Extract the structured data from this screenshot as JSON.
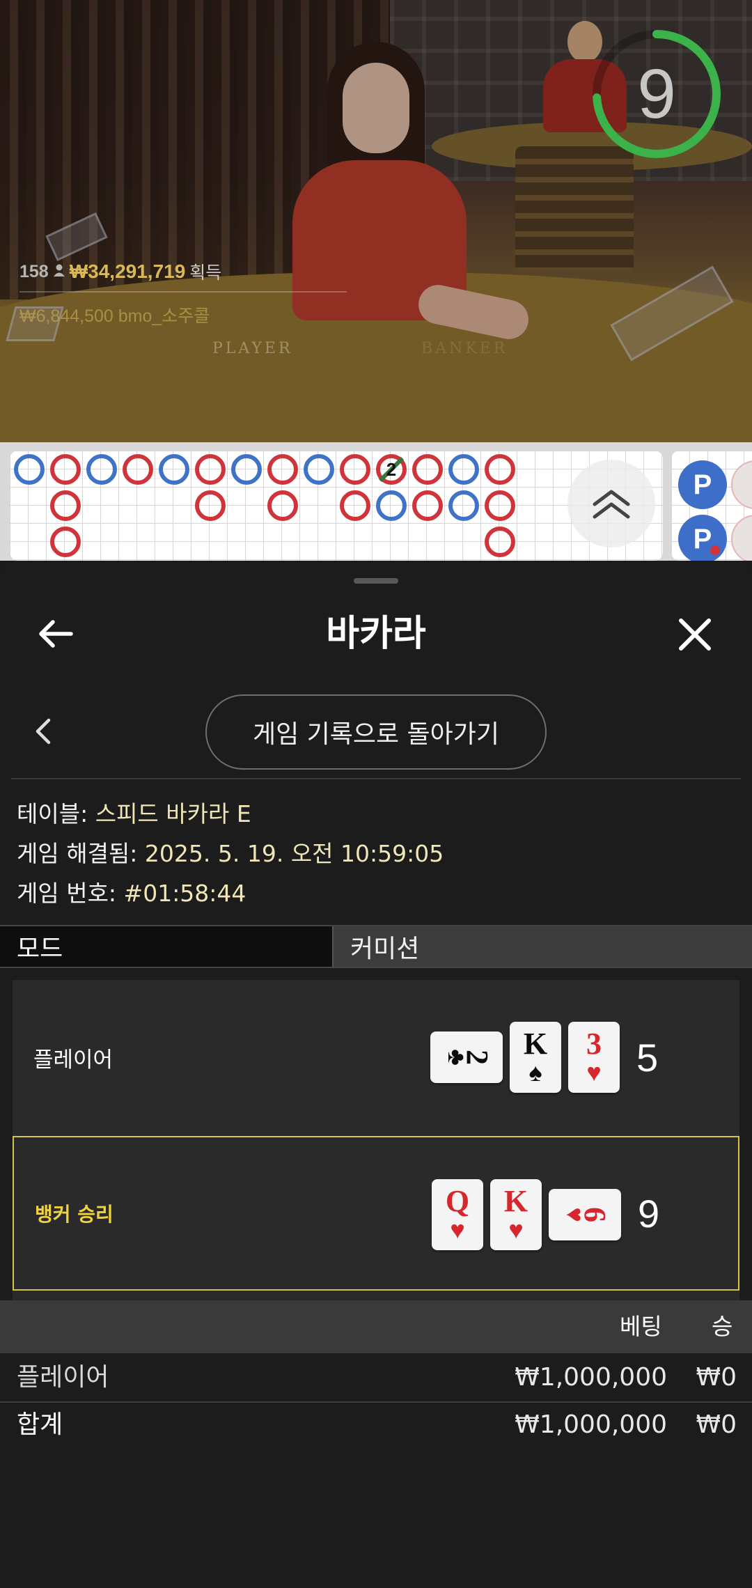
{
  "video": {
    "timer_value": "9",
    "timer_color": "#3cb24a",
    "felt_player": "PLAYER",
    "felt_banker": "BANKER"
  },
  "stats": {
    "players": "158",
    "payout": "₩34,291,719",
    "payout_suffix": "획득",
    "last_win": "₩6,844,500  bmo_소주콜"
  },
  "roadmap": {
    "colors": {
      "banker": "#d0343a",
      "player": "#3f73c8",
      "tie": "#2f7a3a"
    },
    "beads": [
      [
        "P"
      ],
      [
        "B",
        "B",
        "B"
      ],
      [
        "P"
      ],
      [
        "B"
      ],
      [
        "P"
      ],
      [
        "B",
        "B"
      ],
      [
        "P"
      ],
      [
        "B",
        "B"
      ],
      [
        "P"
      ],
      [
        "B",
        "B"
      ],
      [
        "T2",
        "P"
      ],
      [
        "B",
        "B"
      ],
      [
        "P",
        "P"
      ],
      [
        "B",
        "B",
        "B"
      ]
    ],
    "side_badge": "P",
    "scroll_icon": "double-chevron-up-icon"
  },
  "sheet": {
    "title": "바카라",
    "back_icon": "arrow-left-icon",
    "close_icon": "close-icon",
    "nav_prev_icon": "chevron-left-icon",
    "back_to_history": "게임 기록으로 돌아가기",
    "info": {
      "table_label": "테이블: ",
      "table_value": "스피드 바카라 E",
      "resolved_label": "게임 해결됨: ",
      "resolved_value": "2025. 5. 19. 오전 10:59:05",
      "round_label": "게임 번호: ",
      "round_value": "#01:58:44"
    },
    "tabs": {
      "mode": "모드",
      "commission": "커미션"
    },
    "hands": {
      "player": {
        "label": "플레이어",
        "score": "5",
        "cards": [
          {
            "rank": "2",
            "suit": "♣",
            "color": "black",
            "rotated": true
          },
          {
            "rank": "K",
            "suit": "♠",
            "color": "black",
            "rotated": false
          },
          {
            "rank": "3",
            "suit": "♥",
            "color": "red",
            "rotated": false
          }
        ]
      },
      "banker": {
        "label": "뱅커 승리",
        "score": "9",
        "cards": [
          {
            "rank": "Q",
            "suit": "♥",
            "color": "red",
            "rotated": false
          },
          {
            "rank": "K",
            "suit": "♥",
            "color": "red",
            "rotated": false
          },
          {
            "rank": "6",
            "suit": "♥",
            "color": "red",
            "rotated": true
          }
        ]
      }
    },
    "bets": {
      "col_bet": "베팅",
      "col_win": "승",
      "rows": [
        {
          "name": "플레이어",
          "bet": "₩1,000,000",
          "win": "₩0"
        }
      ],
      "total": {
        "name": "합계",
        "bet": "₩1,000,000",
        "win": "₩0"
      }
    }
  }
}
